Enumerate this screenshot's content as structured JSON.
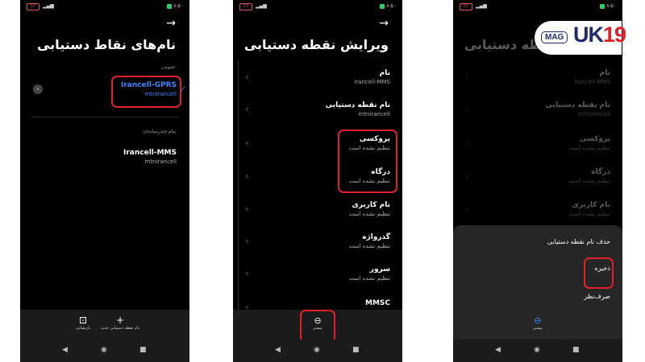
{
  "status": {
    "battery": "57",
    "time": "۸:۵۰"
  },
  "panel1": {
    "title": "نام‌های نقاط دستیابی",
    "section_default": "عمومی",
    "apn1": {
      "name": "Irancell-GPRS",
      "apn": "mtnirancell"
    },
    "section_mms": "پیام چندرسانه‌ای",
    "apn2": {
      "name": "Irancell-MMS",
      "apn": "mtnirancell"
    },
    "reset_label": "بازنشانی",
    "new_apn_label": "نام نقطه دستیابی جدید"
  },
  "panel2": {
    "title": "ویرایش نقطه دستیابی",
    "rows": [
      {
        "label": "نام",
        "value": "Irancell-MMS"
      },
      {
        "label": "نام نقطه دستیابی",
        "value": "mtnirancell"
      },
      {
        "label": "پروکسی",
        "value": "تنظیم نشده است"
      },
      {
        "label": "درگاه",
        "value": "تنظیم نشده است"
      },
      {
        "label": "نام کاربری",
        "value": "تنظیم نشده است"
      },
      {
        "label": "گذرواژه",
        "value": "تنظیم نشده است"
      },
      {
        "label": "سرور",
        "value": "تنظیم نشده است"
      },
      {
        "label": "MMSC",
        "value": ""
      }
    ],
    "more_label": "بیشتر"
  },
  "panel3": {
    "title": "ویرایش نقطه دستیابی",
    "rows": [
      {
        "label": "نام",
        "value": "Irancell-MMS"
      },
      {
        "label": "نام نقطه دستیابی",
        "value": "mtnirancell"
      },
      {
        "label": "پروکسی",
        "value": "تنظیم نشده است"
      },
      {
        "label": "درگاه",
        "value": "تنظیم نشده است"
      },
      {
        "label": "نام کاربری",
        "value": "تنظیم نشده است"
      }
    ],
    "menu": {
      "delete": "حذف نام نقطه دستیابی",
      "save": "ذخیره",
      "discard": "صرف‌نظر"
    },
    "more_label": "بیشتر"
  },
  "logo": {
    "mag": "MAG",
    "main_a": "UK",
    "main_b": "19"
  },
  "icons": {
    "back": "arrow-icon",
    "check": "check-icon",
    "chevron": "chevron-left-icon",
    "reset": "reset-icon",
    "add": "plus-icon",
    "more": "more-icon"
  },
  "colors": {
    "highlight": "#e0202a",
    "selected": "#3a86ff",
    "sheet": "#262626"
  }
}
